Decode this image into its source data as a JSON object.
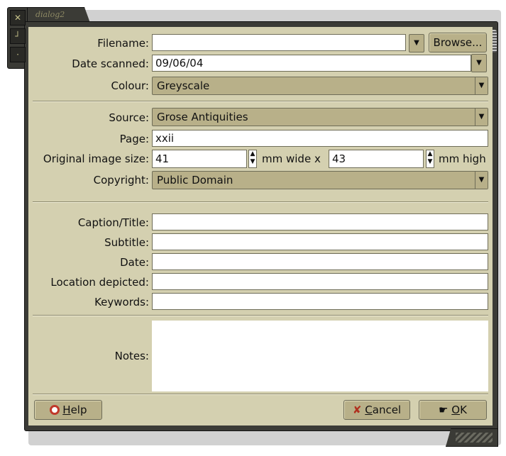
{
  "window": {
    "title": "dialog2"
  },
  "form": {
    "filename": {
      "label": "Filename:",
      "value": ""
    },
    "browse_label": "Browse...",
    "date_scanned": {
      "label": "Date scanned:",
      "value": "09/06/04"
    },
    "colour": {
      "label": "Colour:",
      "value": "Greyscale"
    },
    "source": {
      "label": "Source:",
      "value": "Grose Antiquities"
    },
    "page": {
      "label": "Page:",
      "value": "xxii"
    },
    "original_size": {
      "label": "Original image size:",
      "width": "41",
      "width_unit": "mm wide x",
      "height": "43",
      "height_unit": "mm high"
    },
    "copyright": {
      "label": "Copyright:",
      "value": "Public Domain"
    },
    "caption": {
      "label": "Caption/Title:",
      "value": ""
    },
    "subtitle": {
      "label": "Subtitle:",
      "value": ""
    },
    "date": {
      "label": "Date:",
      "value": ""
    },
    "location": {
      "label": "Location depicted:",
      "value": ""
    },
    "keywords": {
      "label": "Keywords:",
      "value": ""
    },
    "notes": {
      "label": "Notes:",
      "value": ""
    }
  },
  "buttons": {
    "help": {
      "mnemonic": "H",
      "rest": "elp"
    },
    "cancel": {
      "mnemonic": "C",
      "rest": "ancel"
    },
    "ok": {
      "mnemonic": "O",
      "rest": "K"
    }
  },
  "icons": {
    "close": "close-icon",
    "maximize": "maximize-icon",
    "minimize": "minimize-icon"
  }
}
